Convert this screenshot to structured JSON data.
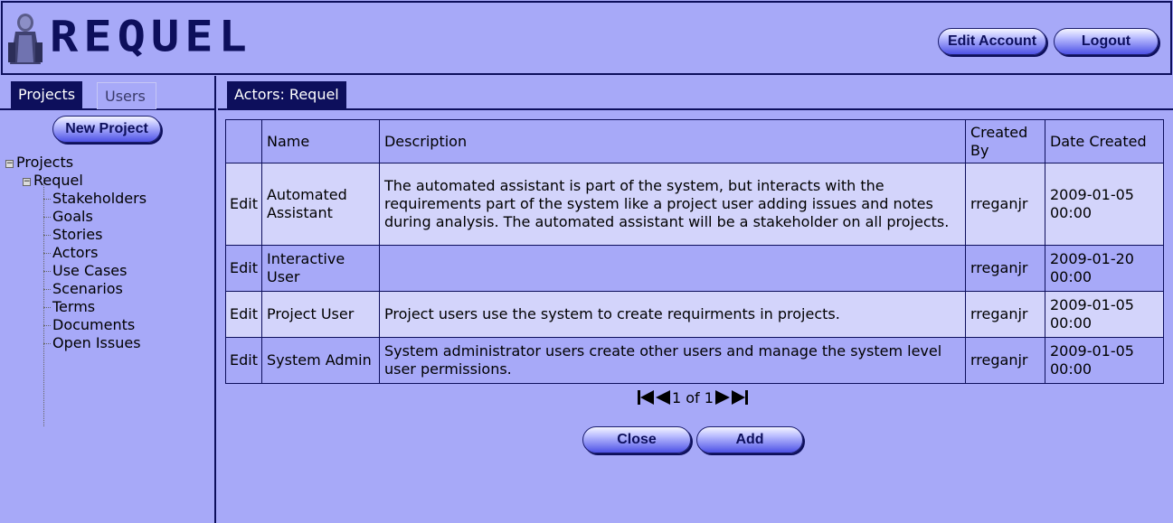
{
  "header": {
    "logo_text": "REQUEL",
    "edit_account_label": "Edit Account",
    "logout_label": "Logout"
  },
  "left": {
    "tabs": [
      {
        "label": "Projects",
        "active": true
      },
      {
        "label": "Users",
        "active": false
      }
    ],
    "new_project_label": "New Project",
    "tree": {
      "root": "Projects",
      "project": "Requel",
      "items": [
        "Stakeholders",
        "Goals",
        "Stories",
        "Actors",
        "Use Cases",
        "Scenarios",
        "Terms",
        "Documents",
        "Open Issues"
      ]
    }
  },
  "main": {
    "tab_label": "Actors: Requel",
    "table": {
      "headers": [
        "",
        "Name",
        "Description",
        "Created By",
        "Date Created"
      ],
      "rows": [
        {
          "edit": "Edit",
          "name": "Automated Assistant",
          "description": "The automated assistant is part of the system, but interacts with the requirements part of the system like a project user adding issues and notes during analysis. The automated assistant will be a stakeholder on all projects.",
          "created_by": "rreganjr",
          "date_created": "2009-01-05 00:00"
        },
        {
          "edit": "Edit",
          "name": "Interactive User",
          "description": "",
          "created_by": "rreganjr",
          "date_created": "2009-01-20 00:00"
        },
        {
          "edit": "Edit",
          "name": "Project User",
          "description": "Project users use the system to create requirments in projects.",
          "created_by": "rreganjr",
          "date_created": "2009-01-05 00:00"
        },
        {
          "edit": "Edit",
          "name": "System Admin",
          "description": "System administrator users create other users and manage the system level user permissions.",
          "created_by": "rreganjr",
          "date_created": "2009-01-05 00:00"
        }
      ]
    },
    "pager": {
      "text": "1 of 1"
    },
    "close_label": "Close",
    "add_label": "Add"
  },
  "colors": {
    "background": "#a7a9f8",
    "dark": "#0d0f5c",
    "row_light": "#d3d4fb"
  }
}
